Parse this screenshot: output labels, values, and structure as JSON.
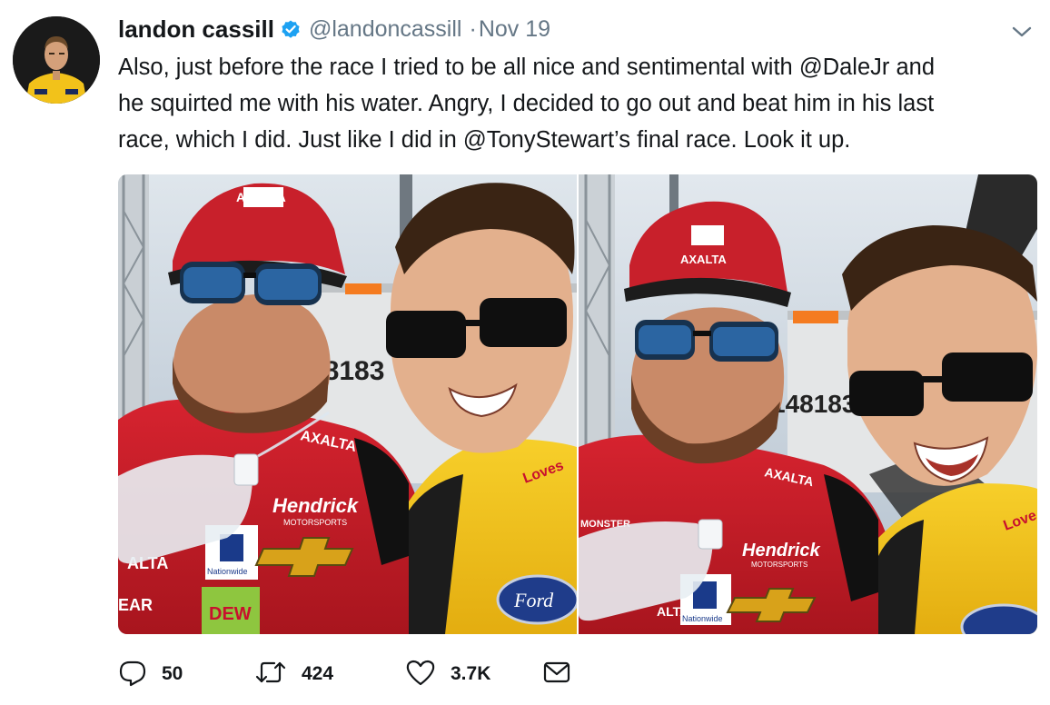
{
  "tweet": {
    "author": {
      "display_name": "landon cassill",
      "handle": "@landoncassill",
      "verified": true
    },
    "separator": "·",
    "date": "Nov 19",
    "text_lines": [
      "Also, just before the race I tried to be all nice and sentimental with @DaleJr and",
      "he squirted me with his water. Angry, I decided to go out and beat him in his last",
      "race, which I did. Just like I did in @TonyStewart’s final race. Look it up."
    ],
    "photos": [
      {
        "wall_number": "48183",
        "cap_text": "AXALTA",
        "suit_brand": "Hendrick",
        "suit_sub": "MOTORSPORTS",
        "nationwide": "Nationwide",
        "dew": "DEW",
        "ford": "Ford",
        "sleeve_text": "AXALTA",
        "chest_text": "ALTA",
        "lower_text": "EAR",
        "love_text": "Loves"
      },
      {
        "wall_number": "148183",
        "cap_text": "AXALTA",
        "suit_brand": "Hendrick",
        "suit_sub": "MOTORSPORTS",
        "nationwide": "Nationwide",
        "sleeve_text": "AXALTA",
        "chest_text": "MONSTER",
        "lower_text": "ALTA",
        "love_text": "Love"
      }
    ],
    "stats": {
      "replies": "50",
      "retweets": "424",
      "likes": "3.7K"
    },
    "colors": {
      "verified_blue": "#1da1f2",
      "muted_gray": "#657786",
      "text": "#14171a"
    },
    "icons": {
      "reply": "reply-icon",
      "retweet": "retweet-icon",
      "like": "heart-icon",
      "message": "envelope-icon",
      "menu": "chevron-down-icon",
      "verified": "verified-badge-icon"
    }
  }
}
